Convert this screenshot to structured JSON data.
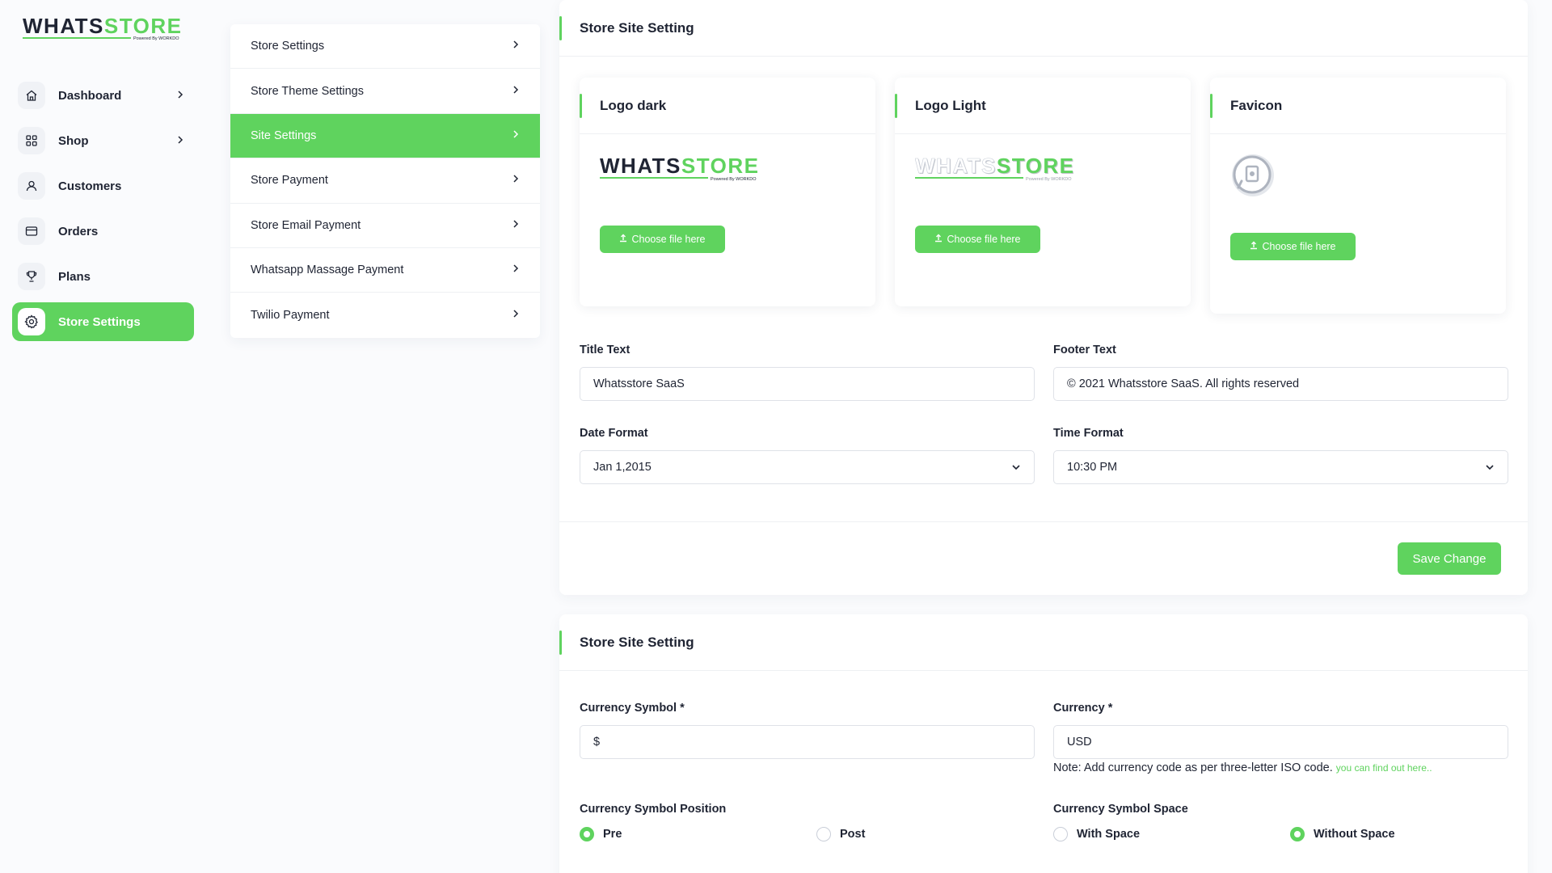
{
  "brand": {
    "name": "WHATSSTORE",
    "tagline": "Powered By WORKDO"
  },
  "sidebar": {
    "items": [
      {
        "label": "Dashboard",
        "icon": "home-icon"
      },
      {
        "label": "Shop",
        "icon": "grid-icon"
      },
      {
        "label": "Customers",
        "icon": "user-icon"
      },
      {
        "label": "Orders",
        "icon": "card-icon"
      },
      {
        "label": "Plans",
        "icon": "trophy-icon"
      },
      {
        "label": "Store Settings",
        "icon": "gear-icon"
      }
    ]
  },
  "settings_menu": {
    "items": [
      {
        "label": "Store Settings"
      },
      {
        "label": "Store Theme Settings"
      },
      {
        "label": "Site Settings"
      },
      {
        "label": "Store Payment"
      },
      {
        "label": "Store Email Payment"
      },
      {
        "label": "Whatsapp Massage Payment"
      },
      {
        "label": "Twilio Payment"
      }
    ]
  },
  "site_setting": {
    "title": "Store Site Setting",
    "logo_dark": {
      "title": "Logo dark",
      "button": "Choose file here"
    },
    "logo_light": {
      "title": "Logo Light",
      "button": "Choose file here"
    },
    "favicon": {
      "title": "Favicon",
      "button": "Choose file here"
    },
    "title_text": {
      "label": "Title Text",
      "value": "Whatsstore SaaS"
    },
    "footer_text": {
      "label": "Footer Text",
      "value": "© 2021 Whatsstore SaaS. All rights reserved"
    },
    "date_format": {
      "label": "Date Format",
      "value": "Jan 1,2015"
    },
    "time_format": {
      "label": "Time Format",
      "value": "10:30 PM"
    },
    "save_label": "Save Change"
  },
  "currency_setting": {
    "title": "Store Site Setting",
    "currency_symbol": {
      "label": "Currency Symbol *",
      "value": "$"
    },
    "currency": {
      "label": "Currency *",
      "value": "USD"
    },
    "note": "Note: Add currency code as per three-letter ISO code.",
    "note_link": "you can find out here..",
    "symbol_position": {
      "label": "Currency Symbol Position",
      "options": [
        "Pre",
        "Post"
      ],
      "selected": "Pre"
    },
    "symbol_space": {
      "label": "Currency Symbol Space",
      "options": [
        "With Space",
        "Without Space"
      ],
      "selected": "Without Space"
    }
  },
  "colors": {
    "accent": "#5fd35e",
    "text": "#1f2433",
    "background": "#fafbfd"
  }
}
